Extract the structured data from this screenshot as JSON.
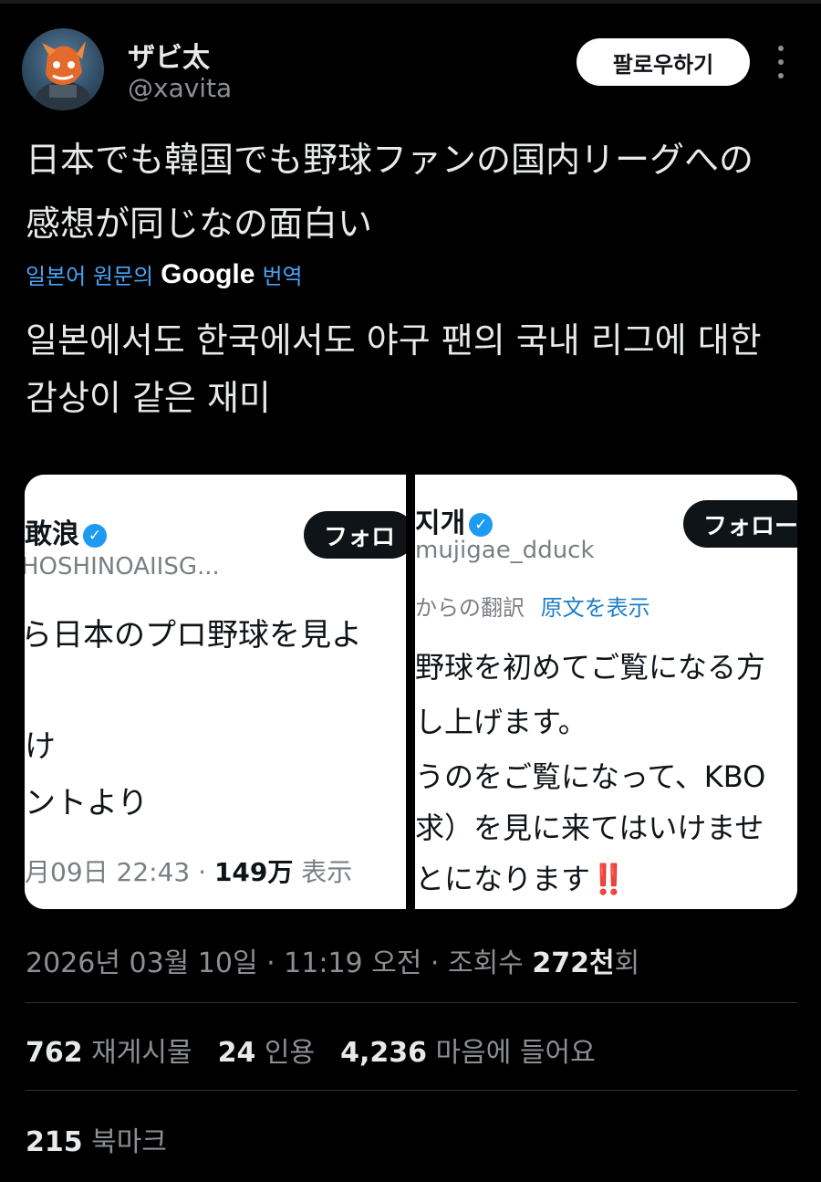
{
  "user": {
    "name": "ザビ太",
    "handle": "@xavita"
  },
  "header": {
    "follow_label": "팔로우하기"
  },
  "tweet": {
    "text_line1": "日本でも韓国でも野球ファンの国内リーグへの",
    "text_line2": "感想が同じなの面白い",
    "translation_label_prefix": "일본어 원문의",
    "translation_label_google": "Google",
    "translation_label_suffix": "번역",
    "translated_line1": "일본에서도 한국에서도 야구 팬의 국내 리그에 대한",
    "translated_line2": "감상이 같은 재미"
  },
  "media": {
    "left": {
      "name": "敢浪",
      "handle": "HOSHINOAIISG...",
      "follow_label": "フォロ",
      "line1": "ら日本のプロ野球を見よ",
      "line2": "け",
      "line3": "ントより",
      "date": "月09日 22:43 ·",
      "views_number": "149万",
      "views_suffix": "表示"
    },
    "right": {
      "name": "지개",
      "handle": "mujigae_dduck",
      "follow_label": "フォロー",
      "translate_from": "からの翻訳",
      "show_original": "原文を表示",
      "line1": "野球を初めてご覧になる方",
      "line2": "し上げます。",
      "line3": "うのをご覧になって、KBO",
      "line4": "求）を見に来てはいけませ",
      "line5": "とになります‼️"
    }
  },
  "meta": {
    "timestamp": "2026년 03월 10일 · 11:19 오전 · 조회수",
    "views_number": "272천",
    "views_suffix": "회"
  },
  "stats": {
    "reposts_count": "762",
    "reposts_label": "재게시물",
    "quotes_count": "24",
    "quotes_label": "인용",
    "likes_count": "4,236",
    "likes_label": "마음에 들어요"
  },
  "bookmarks": {
    "count": "215",
    "label": "북마크"
  },
  "colors": {
    "background": "#000000",
    "link_blue": "#4aa3f5",
    "verified_blue": "#1d9bf0",
    "muted": "#8b8f94"
  }
}
